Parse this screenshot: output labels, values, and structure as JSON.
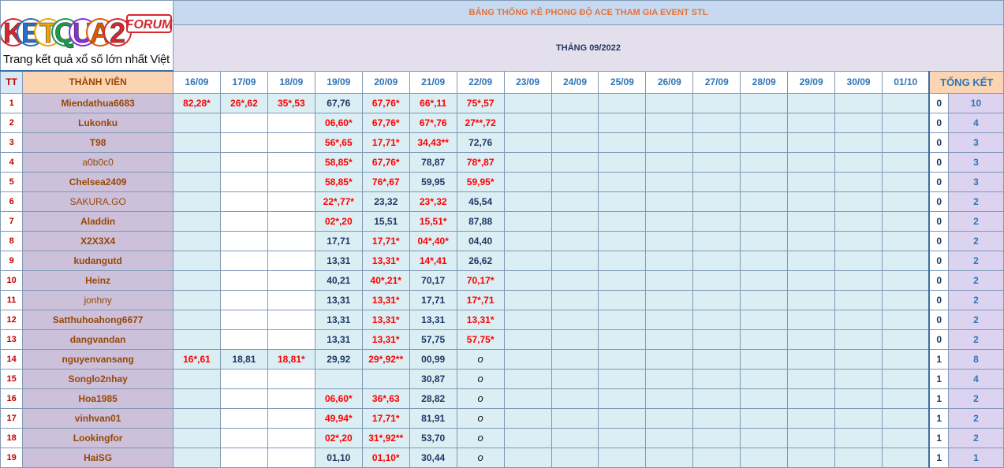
{
  "logo": {
    "letters": [
      "K",
      "E",
      "T",
      "Q",
      "U",
      "A",
      "2"
    ],
    "letter_colors": [
      "#d7262e",
      "#2b6cc4",
      "#f5a100",
      "#1a9a4a",
      "#8a2be2",
      "#e05a00",
      "#d7262e"
    ],
    "badge": "FORUM",
    "badge_color": "#d7262e",
    "tagline": "Trang kết quả xổ số lớn nhất Việt Nam"
  },
  "title": "BẢNG THỐNG KÊ PHONG ĐỘ ACE THAM GIA EVENT STL",
  "month": "THÁNG 09/2022",
  "headers": {
    "tt": "TT",
    "member": "THÀNH VIÊN",
    "dates": [
      "16/09",
      "17/09",
      "18/09",
      "19/09",
      "20/09",
      "21/09",
      "22/09",
      "23/09",
      "24/09",
      "25/09",
      "26/09",
      "27/09",
      "28/09",
      "29/09",
      "30/09",
      "01/10"
    ],
    "total": "TỔNG KẾT"
  },
  "colors": {
    "red_value": "#ff0000",
    "navy_value": "#1f3864",
    "name_bg": "#ccc0da",
    "cell_bg": "#daeef3",
    "title_bg": "#c6d9f1"
  },
  "rows": [
    {
      "tt": "1",
      "name": "Miendathua6683",
      "cells": [
        {
          "v": "82,28*",
          "c": "r"
        },
        {
          "v": "26*,62",
          "c": "r"
        },
        {
          "v": "35*,53",
          "c": "r"
        },
        {
          "v": "67,76",
          "c": "n"
        },
        {
          "v": "67,76*",
          "c": "r"
        },
        {
          "v": "66*,11",
          "c": "r"
        },
        {
          "v": "75*,57",
          "c": "r"
        }
      ],
      "total1": "0",
      "total2": "10"
    },
    {
      "tt": "2",
      "name": "Lukonku",
      "cells": [
        {
          "v": "",
          "c": "n"
        },
        {
          "v": "",
          "c": "n"
        },
        {
          "v": "",
          "c": "n"
        },
        {
          "v": "06,60*",
          "c": "r"
        },
        {
          "v": "67,76*",
          "c": "r"
        },
        {
          "v": "67*,76",
          "c": "r"
        },
        {
          "v": "27**,72",
          "c": "r"
        }
      ],
      "total1": "0",
      "total2": "4"
    },
    {
      "tt": "3",
      "name": "T98",
      "cells": [
        {
          "v": "",
          "c": "n"
        },
        {
          "v": "",
          "c": "n"
        },
        {
          "v": "",
          "c": "n"
        },
        {
          "v": "56*,65",
          "c": "r"
        },
        {
          "v": "17,71*",
          "c": "r"
        },
        {
          "v": "34,43**",
          "c": "r"
        },
        {
          "v": "72,76",
          "c": "n"
        }
      ],
      "total1": "0",
      "total2": "3"
    },
    {
      "tt": "4",
      "name": "a0b0c0",
      "plain": true,
      "cells": [
        {
          "v": "",
          "c": "n"
        },
        {
          "v": "",
          "c": "n"
        },
        {
          "v": "",
          "c": "n"
        },
        {
          "v": "58,85*",
          "c": "r"
        },
        {
          "v": "67,76*",
          "c": "r"
        },
        {
          "v": "78,87",
          "c": "n"
        },
        {
          "v": "78*,87",
          "c": "r"
        }
      ],
      "total1": "0",
      "total2": "3"
    },
    {
      "tt": "5",
      "name": "Chelsea2409",
      "cells": [
        {
          "v": "",
          "c": "n"
        },
        {
          "v": "",
          "c": "n"
        },
        {
          "v": "",
          "c": "n"
        },
        {
          "v": "58,85*",
          "c": "r"
        },
        {
          "v": "76*,67",
          "c": "r"
        },
        {
          "v": "59,95",
          "c": "n"
        },
        {
          "v": "59,95*",
          "c": "r"
        }
      ],
      "total1": "0",
      "total2": "3"
    },
    {
      "tt": "6",
      "name": "SAKURA.GO",
      "plain": true,
      "cells": [
        {
          "v": "",
          "c": "n"
        },
        {
          "v": "",
          "c": "n"
        },
        {
          "v": "",
          "c": "n"
        },
        {
          "v": "22*,77*",
          "c": "r"
        },
        {
          "v": "23,32",
          "c": "n"
        },
        {
          "v": "23*,32",
          "c": "r"
        },
        {
          "v": "45,54",
          "c": "n"
        }
      ],
      "total1": "0",
      "total2": "2"
    },
    {
      "tt": "7",
      "name": "Aladdin",
      "cells": [
        {
          "v": "",
          "c": "n"
        },
        {
          "v": "",
          "c": "n"
        },
        {
          "v": "",
          "c": "n"
        },
        {
          "v": "02*,20",
          "c": "r"
        },
        {
          "v": "15,51",
          "c": "n"
        },
        {
          "v": "15,51*",
          "c": "r"
        },
        {
          "v": "87,88",
          "c": "n"
        }
      ],
      "total1": "0",
      "total2": "2"
    },
    {
      "tt": "8",
      "name": "X2X3X4",
      "cells": [
        {
          "v": "",
          "c": "n"
        },
        {
          "v": "",
          "c": "n"
        },
        {
          "v": "",
          "c": "n"
        },
        {
          "v": "17,71",
          "c": "n"
        },
        {
          "v": "17,71*",
          "c": "r"
        },
        {
          "v": "04*,40*",
          "c": "r"
        },
        {
          "v": "04,40",
          "c": "n"
        }
      ],
      "total1": "0",
      "total2": "2"
    },
    {
      "tt": "9",
      "name": "kudangutd",
      "cells": [
        {
          "v": "",
          "c": "n"
        },
        {
          "v": "",
          "c": "n"
        },
        {
          "v": "",
          "c": "n"
        },
        {
          "v": "13,31",
          "c": "n"
        },
        {
          "v": "13,31*",
          "c": "r"
        },
        {
          "v": "14*,41",
          "c": "r"
        },
        {
          "v": "26,62",
          "c": "n"
        }
      ],
      "total1": "0",
      "total2": "2"
    },
    {
      "tt": "10",
      "name": "Heinz",
      "cells": [
        {
          "v": "",
          "c": "n"
        },
        {
          "v": "",
          "c": "n"
        },
        {
          "v": "",
          "c": "n"
        },
        {
          "v": "40,21",
          "c": "n"
        },
        {
          "v": "40*,21*",
          "c": "r"
        },
        {
          "v": "70,17",
          "c": "n"
        },
        {
          "v": "70,17*",
          "c": "r"
        }
      ],
      "total1": "0",
      "total2": "2"
    },
    {
      "tt": "11",
      "name": "jonhny",
      "plain": true,
      "cells": [
        {
          "v": "",
          "c": "n"
        },
        {
          "v": "",
          "c": "n"
        },
        {
          "v": "",
          "c": "n"
        },
        {
          "v": "13,31",
          "c": "n"
        },
        {
          "v": "13,31*",
          "c": "r"
        },
        {
          "v": "17,71",
          "c": "n"
        },
        {
          "v": "17*,71",
          "c": "r"
        }
      ],
      "total1": "0",
      "total2": "2"
    },
    {
      "tt": "12",
      "name": "Satthuhoahong6677",
      "cells": [
        {
          "v": "",
          "c": "n"
        },
        {
          "v": "",
          "c": "n"
        },
        {
          "v": "",
          "c": "n"
        },
        {
          "v": "13,31",
          "c": "n"
        },
        {
          "v": "13,31*",
          "c": "r"
        },
        {
          "v": "13,31",
          "c": "n"
        },
        {
          "v": "13,31*",
          "c": "r"
        }
      ],
      "total1": "0",
      "total2": "2"
    },
    {
      "tt": "13",
      "name": "dangvandan",
      "cells": [
        {
          "v": "",
          "c": "n"
        },
        {
          "v": "",
          "c": "n"
        },
        {
          "v": "",
          "c": "n"
        },
        {
          "v": "13,31",
          "c": "n"
        },
        {
          "v": "13,31*",
          "c": "r"
        },
        {
          "v": "57,75",
          "c": "n"
        },
        {
          "v": "57,75*",
          "c": "r"
        }
      ],
      "total1": "0",
      "total2": "2"
    },
    {
      "tt": "14",
      "name": "nguyenvansang",
      "cells": [
        {
          "v": "16*,61",
          "c": "r"
        },
        {
          "v": "18,81",
          "c": "n"
        },
        {
          "v": "18,81*",
          "c": "r"
        },
        {
          "v": "29,92",
          "c": "n"
        },
        {
          "v": "29*,92**",
          "c": "r"
        },
        {
          "v": "00,99",
          "c": "n"
        },
        {
          "v": "o",
          "c": "o"
        }
      ],
      "total1": "1",
      "total2": "8"
    },
    {
      "tt": "15",
      "name": "Songlo2nhay",
      "cells": [
        {
          "v": "",
          "c": "n"
        },
        {
          "v": "",
          "c": "n"
        },
        {
          "v": "",
          "c": "n"
        },
        {
          "v": "",
          "c": "n"
        },
        {
          "v": "",
          "c": "n"
        },
        {
          "v": "30,87",
          "c": "n"
        },
        {
          "v": "o",
          "c": "o"
        }
      ],
      "total1": "1",
      "total2": "4"
    },
    {
      "tt": "16",
      "name": "Hoa1985",
      "cells": [
        {
          "v": "",
          "c": "n"
        },
        {
          "v": "",
          "c": "n"
        },
        {
          "v": "",
          "c": "n"
        },
        {
          "v": "06,60*",
          "c": "r"
        },
        {
          "v": "36*,63",
          "c": "r"
        },
        {
          "v": "28,82",
          "c": "n"
        },
        {
          "v": "o",
          "c": "o"
        }
      ],
      "total1": "1",
      "total2": "2"
    },
    {
      "tt": "17",
      "name": "vinhvan01",
      "cells": [
        {
          "v": "",
          "c": "n"
        },
        {
          "v": "",
          "c": "n"
        },
        {
          "v": "",
          "c": "n"
        },
        {
          "v": "49,94*",
          "c": "r"
        },
        {
          "v": "17,71*",
          "c": "r"
        },
        {
          "v": "81,91",
          "c": "n"
        },
        {
          "v": "o",
          "c": "o"
        }
      ],
      "total1": "1",
      "total2": "2"
    },
    {
      "tt": "18",
      "name": "Lookingfor",
      "cells": [
        {
          "v": "",
          "c": "n"
        },
        {
          "v": "",
          "c": "n"
        },
        {
          "v": "",
          "c": "n"
        },
        {
          "v": "02*,20",
          "c": "r"
        },
        {
          "v": "31*,92**",
          "c": "r"
        },
        {
          "v": "53,70",
          "c": "n"
        },
        {
          "v": "o",
          "c": "o"
        }
      ],
      "total1": "1",
      "total2": "2"
    },
    {
      "tt": "19",
      "name": "HaiSG",
      "cells": [
        {
          "v": "",
          "c": "n"
        },
        {
          "v": "",
          "c": "n"
        },
        {
          "v": "",
          "c": "n"
        },
        {
          "v": "01,10",
          "c": "n"
        },
        {
          "v": "01,10*",
          "c": "r"
        },
        {
          "v": "30,44",
          "c": "n"
        },
        {
          "v": "o",
          "c": "o"
        }
      ],
      "total1": "1",
      "total2": "1"
    }
  ]
}
